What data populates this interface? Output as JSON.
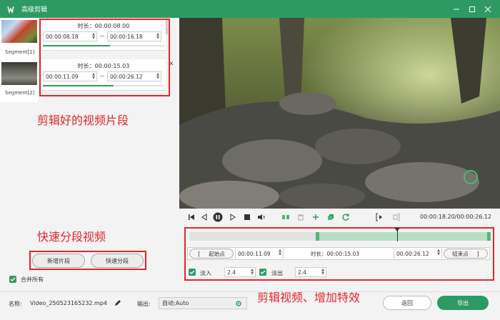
{
  "window": {
    "title": "高级剪辑",
    "icons": [
      "app-logo-icon",
      "minimize-icon",
      "maximize-icon",
      "close-icon"
    ]
  },
  "thumbnails": [
    {
      "label": "Segment[1]"
    },
    {
      "label": "Segment[2]"
    }
  ],
  "segments": [
    {
      "duration": "时长：00:00:08.00",
      "start": "00:00:08.18",
      "end": "00:00:16.18",
      "progress": 0.55
    },
    {
      "duration": "时长：00:00:15.03",
      "start": "00:00:11.09",
      "end": "00:00:26.12",
      "progress": 0.58
    }
  ],
  "annotations": {
    "clips": "剪辑好的视频片段",
    "split": "快速分段视频",
    "edit": "剪辑视频、增加特效"
  },
  "left_actions": {
    "add_segment": "新增片段",
    "quick_split": "快速分段",
    "merge_all": "合并所有"
  },
  "player": {
    "time": "00:00:18.20/00:00:26.12",
    "icons": [
      "skip-start-icon",
      "prev-frame-icon",
      "pause-icon",
      "next-frame-icon",
      "stop-icon",
      "volume-icon",
      "split-icon",
      "delete-icon",
      "add-icon",
      "copy-icon",
      "reset-icon",
      "mark-in-icon",
      "mark-out-icon"
    ]
  },
  "timeline": {
    "selection_start": 0.42,
    "selection_end": 1.0,
    "playhead": 0.69
  },
  "trim": {
    "start_button": "起始点",
    "start_time": "00:00:11.09",
    "duration": "时长：00:00:15.03",
    "end_time": "00:00:26.12",
    "end_button": "结束点",
    "bracket_left": "[",
    "bracket_right": "]"
  },
  "fade": {
    "fade_in_label": "淡入",
    "fade_in_value": "2.4",
    "fade_out_label": "淡出",
    "fade_out_value": "2.4"
  },
  "footer": {
    "name_label": "名称:",
    "name_value": "Video_250523165232.mp4",
    "output_label": "输出:",
    "output_value": "自动;Auto",
    "back": "返回",
    "export": "导出"
  },
  "colors": {
    "brand": "#2e9a63",
    "annotation": "#e8242b"
  }
}
